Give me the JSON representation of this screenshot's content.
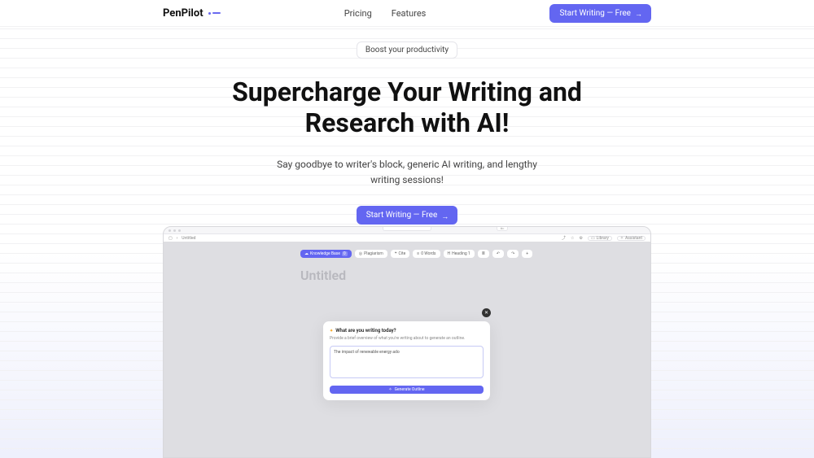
{
  "header": {
    "logo": "PenPilot",
    "nav": {
      "pricing": "Pricing",
      "features": "Features"
    },
    "cta": "Start Writing — Free"
  },
  "hero": {
    "badge": "Boost your productivity",
    "title": "Supercharge Your Writing and Research with AI!",
    "subtitle": "Say goodbye to writer's block, generic AI writing, and lengthy writing sessions!",
    "cta": "Start Writing — Free"
  },
  "mock": {
    "tab_label": "",
    "search_pill": "⌘K",
    "breadcrumb_back": "‹",
    "breadcrumb_title": "Untitled",
    "right_bar": {
      "library": "Library",
      "assistant": "Assistant"
    },
    "toolbar": {
      "kb": "Knowledge Base",
      "kb_count": "0",
      "plagiarism": "Plagiarism",
      "cite": "Cite",
      "words": "0 Words",
      "heading": "Heading 1"
    },
    "doc_title": "Untitled",
    "modal": {
      "title": "What are you writing today?",
      "subtitle": "Provide a brief overview of what you're writing about to generate an outline.",
      "input": "The impact of renewable energy ado",
      "button": "Generate Outline"
    }
  }
}
